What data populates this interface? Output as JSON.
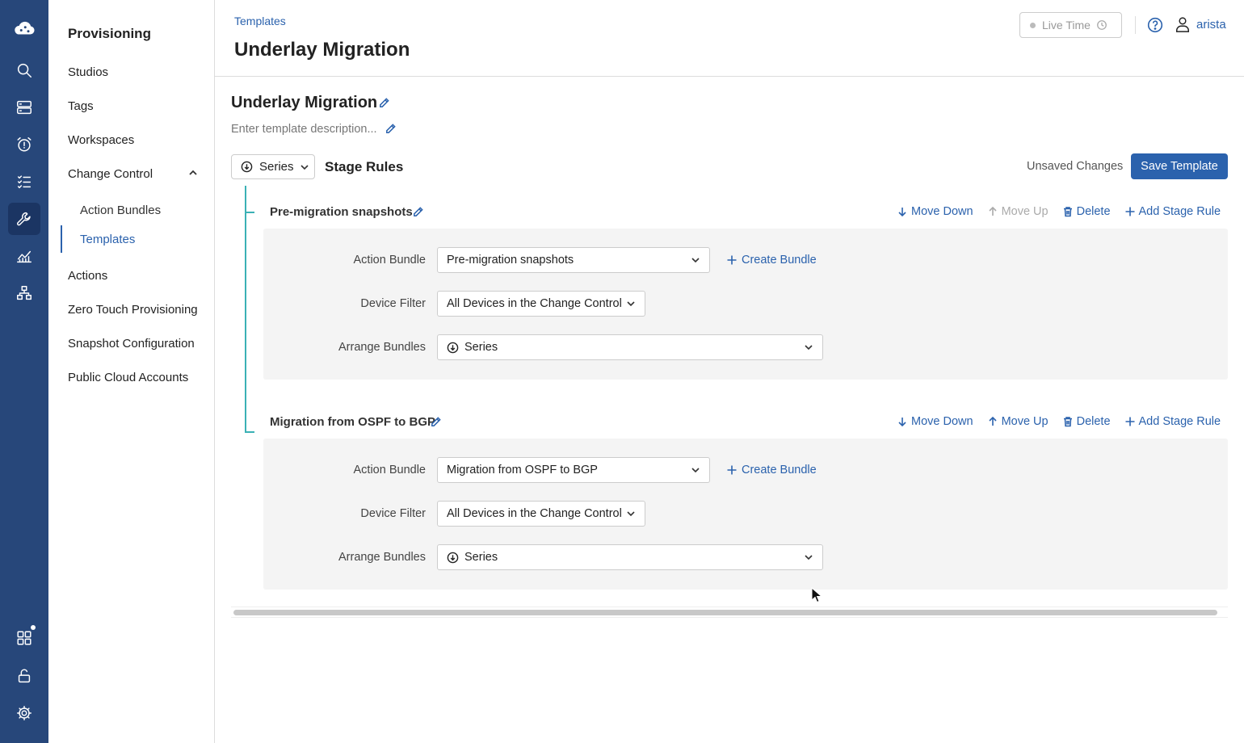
{
  "sidebar": {
    "title": "Provisioning",
    "items": {
      "studios": "Studios",
      "tags": "Tags",
      "workspaces": "Workspaces",
      "change_control": "Change Control",
      "action_bundles": "Action Bundles",
      "templates": "Templates",
      "actions": "Actions",
      "ztp": "Zero Touch Provisioning",
      "snapshot_config": "Snapshot Configuration",
      "public_cloud": "Public Cloud Accounts"
    }
  },
  "header": {
    "breadcrumb": "Templates",
    "title": "Underlay Migration",
    "live_time": "Live Time",
    "user": "arista"
  },
  "template": {
    "name": "Underlay Migration",
    "description_placeholder": "Enter template description...",
    "arrangement": "Series",
    "section_title": "Stage Rules",
    "unsaved": "Unsaved Changes",
    "save_label": "Save Template"
  },
  "labels": {
    "action_bundle": "Action Bundle",
    "device_filter": "Device Filter",
    "arrange_bundles": "Arrange Bundles",
    "create_bundle": "Create Bundle",
    "move_down": "Move Down",
    "move_up": "Move Up",
    "delete": "Delete",
    "add_stage_rule": "Add Stage Rule"
  },
  "stages": [
    {
      "title": "Pre-migration snapshots",
      "action_bundle": "Pre-migration snapshots",
      "device_filter": "All Devices in the Change Control",
      "arrange": "Series",
      "move_up_enabled": false
    },
    {
      "title": "Migration from OSPF to BGP",
      "action_bundle": "Migration from OSPF to BGP",
      "device_filter": "All Devices in the Change Control",
      "arrange": "Series",
      "move_up_enabled": true
    }
  ],
  "colors": {
    "rail": "#27477a",
    "accent": "#2b62ad",
    "tree": "#3bb1b5"
  }
}
